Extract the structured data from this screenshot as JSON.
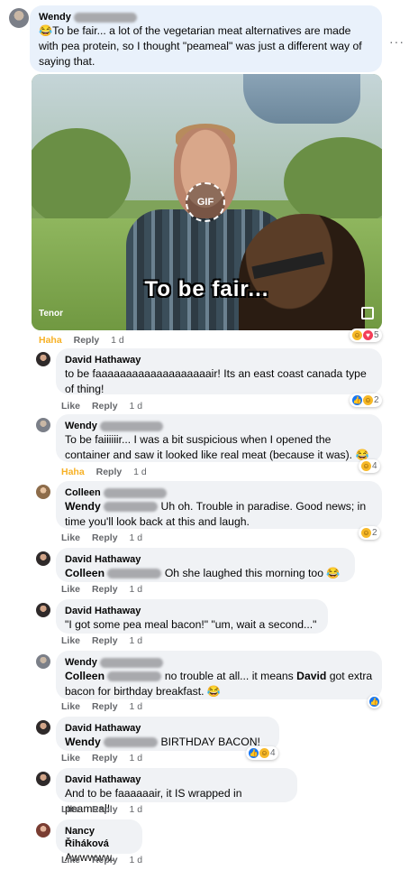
{
  "main": {
    "name": "Wendy",
    "text": "😂To be fair... a lot of the vegetarian meat alternatives are made with pea protein, so I thought \"peameal\" was just a different way of saying that.",
    "gif": {
      "caption": "To be fair...",
      "badge": "GIF",
      "provider": "Tenor"
    },
    "actions": {
      "reaction": "Haha",
      "reply": "Reply",
      "time": "1 d"
    },
    "reactions": {
      "count": "5",
      "icons": [
        "haha-icon",
        "love-icon"
      ]
    }
  },
  "replies": [
    {
      "name": "David Hathaway",
      "text": "to be faaaaaaaaaaaaaaaaaaair! Its an east coast canada type of thing!",
      "actions": {
        "like": "Like",
        "reply": "Reply",
        "time": "1 d"
      },
      "reactions": {
        "count": "2"
      }
    },
    {
      "name": "Wendy",
      "text": "To be faiiiiiir... I was a bit suspicious when I opened the container and saw it looked like real meat (because it was). 😂",
      "actions": {
        "reaction": "Haha",
        "reply": "Reply",
        "time": "1 d"
      },
      "reactions": {
        "count": "4"
      }
    },
    {
      "name": "Colleen",
      "mention": "Wendy",
      "text": "Uh oh. Trouble in paradise. Good news; in time you'll look back at this and laugh.",
      "actions": {
        "like": "Like",
        "reply": "Reply",
        "time": "1 d"
      },
      "reactions": {
        "count": "2"
      }
    },
    {
      "name": "David Hathaway",
      "mention": "Colleen",
      "text": "Oh she laughed this morning too 😂",
      "actions": {
        "like": "Like",
        "reply": "Reply",
        "time": "1 d"
      }
    },
    {
      "name": "David Hathaway",
      "text": "\"I got some pea meal bacon!\" \"um, wait a second...\"",
      "actions": {
        "like": "Like",
        "reply": "Reply",
        "time": "1 d"
      }
    },
    {
      "name": "Wendy",
      "mention": "Colleen",
      "text_a": "no trouble at all... it means",
      "mention_b": "David",
      "text_b": "got extra bacon for birthday breakfast. 😂",
      "actions": {
        "like": "Like",
        "reply": "Reply",
        "time": "1 d"
      }
    },
    {
      "name": "David Hathaway",
      "mention": "Wendy",
      "text": "BIRTHDAY BACON!",
      "actions": {
        "like": "Like",
        "reply": "Reply",
        "time": "1 d"
      },
      "reactions": {
        "count": "4"
      }
    },
    {
      "name": "David Hathaway",
      "text": "And to be faaaaaair, it IS wrapped in peameal!",
      "actions": {
        "like": "Like",
        "reply": "Reply",
        "time": "1 d"
      }
    },
    {
      "name": "Nancy Řiháková",
      "text": "Awwwww.",
      "actions": {
        "like": "Like",
        "reply": "Reply",
        "time": "1 d"
      }
    }
  ],
  "colors": {
    "bubble": "#f0f2f5",
    "haha": "#f7b125",
    "muted": "#65676b",
    "like": "#1877f2"
  }
}
